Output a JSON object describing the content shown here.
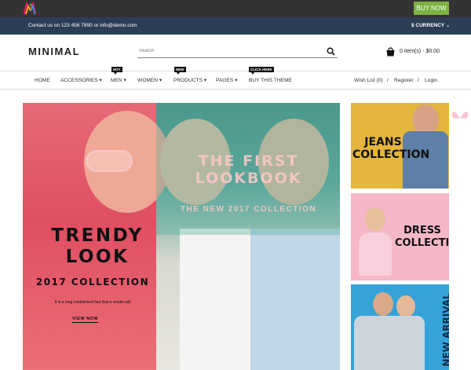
{
  "topbar": {
    "buy_now": "BUY NOW"
  },
  "infobar": {
    "contact": "Contact us on 123 456 7890 or info@demo.com",
    "currency": "$ CURRENCY ⌄"
  },
  "header": {
    "brand": "MINIMAL",
    "search_placeholder": "Search",
    "cart": "0 item(s) - $0.00"
  },
  "nav": {
    "items": [
      {
        "label": "HOME"
      },
      {
        "label": "ACCESSORIES ▾"
      },
      {
        "label": "MEN ▾",
        "badge": "HOT"
      },
      {
        "label": "WOMEN ▾"
      },
      {
        "label": "PRODUCTS ▾",
        "badge": "NEW"
      },
      {
        "label": "PAGES ▾"
      },
      {
        "label": "BUY THIS THEME",
        "badge": "CLICK HERE"
      }
    ],
    "wishlist": "Wish List (0)",
    "register": "Register",
    "login": "Login",
    "separator": "/"
  },
  "hero": {
    "lookbook_title": "THE FIRST LOOKBOOK",
    "lookbook_sub": "THE NEW 2017 COLLECTION",
    "trendy": "TRENDY LOOK",
    "collection": "2017 COLLECTION",
    "desc": "It is a long established fact that a reader will",
    "cta": "VIEW NOW"
  },
  "banners": {
    "jeans": "JEANS COLLECTION",
    "dress": "DRESS COLLECTION",
    "arrival": "NEW ARRIVAL"
  },
  "colors": {
    "topbar": "#333333",
    "infobar": "#2c3e55",
    "buy_now": "#7cb342",
    "hero_pink": "#e35a6a",
    "jeans": "#e4b63c",
    "dress": "#f6b7c9",
    "arrival": "#35a3d8"
  }
}
